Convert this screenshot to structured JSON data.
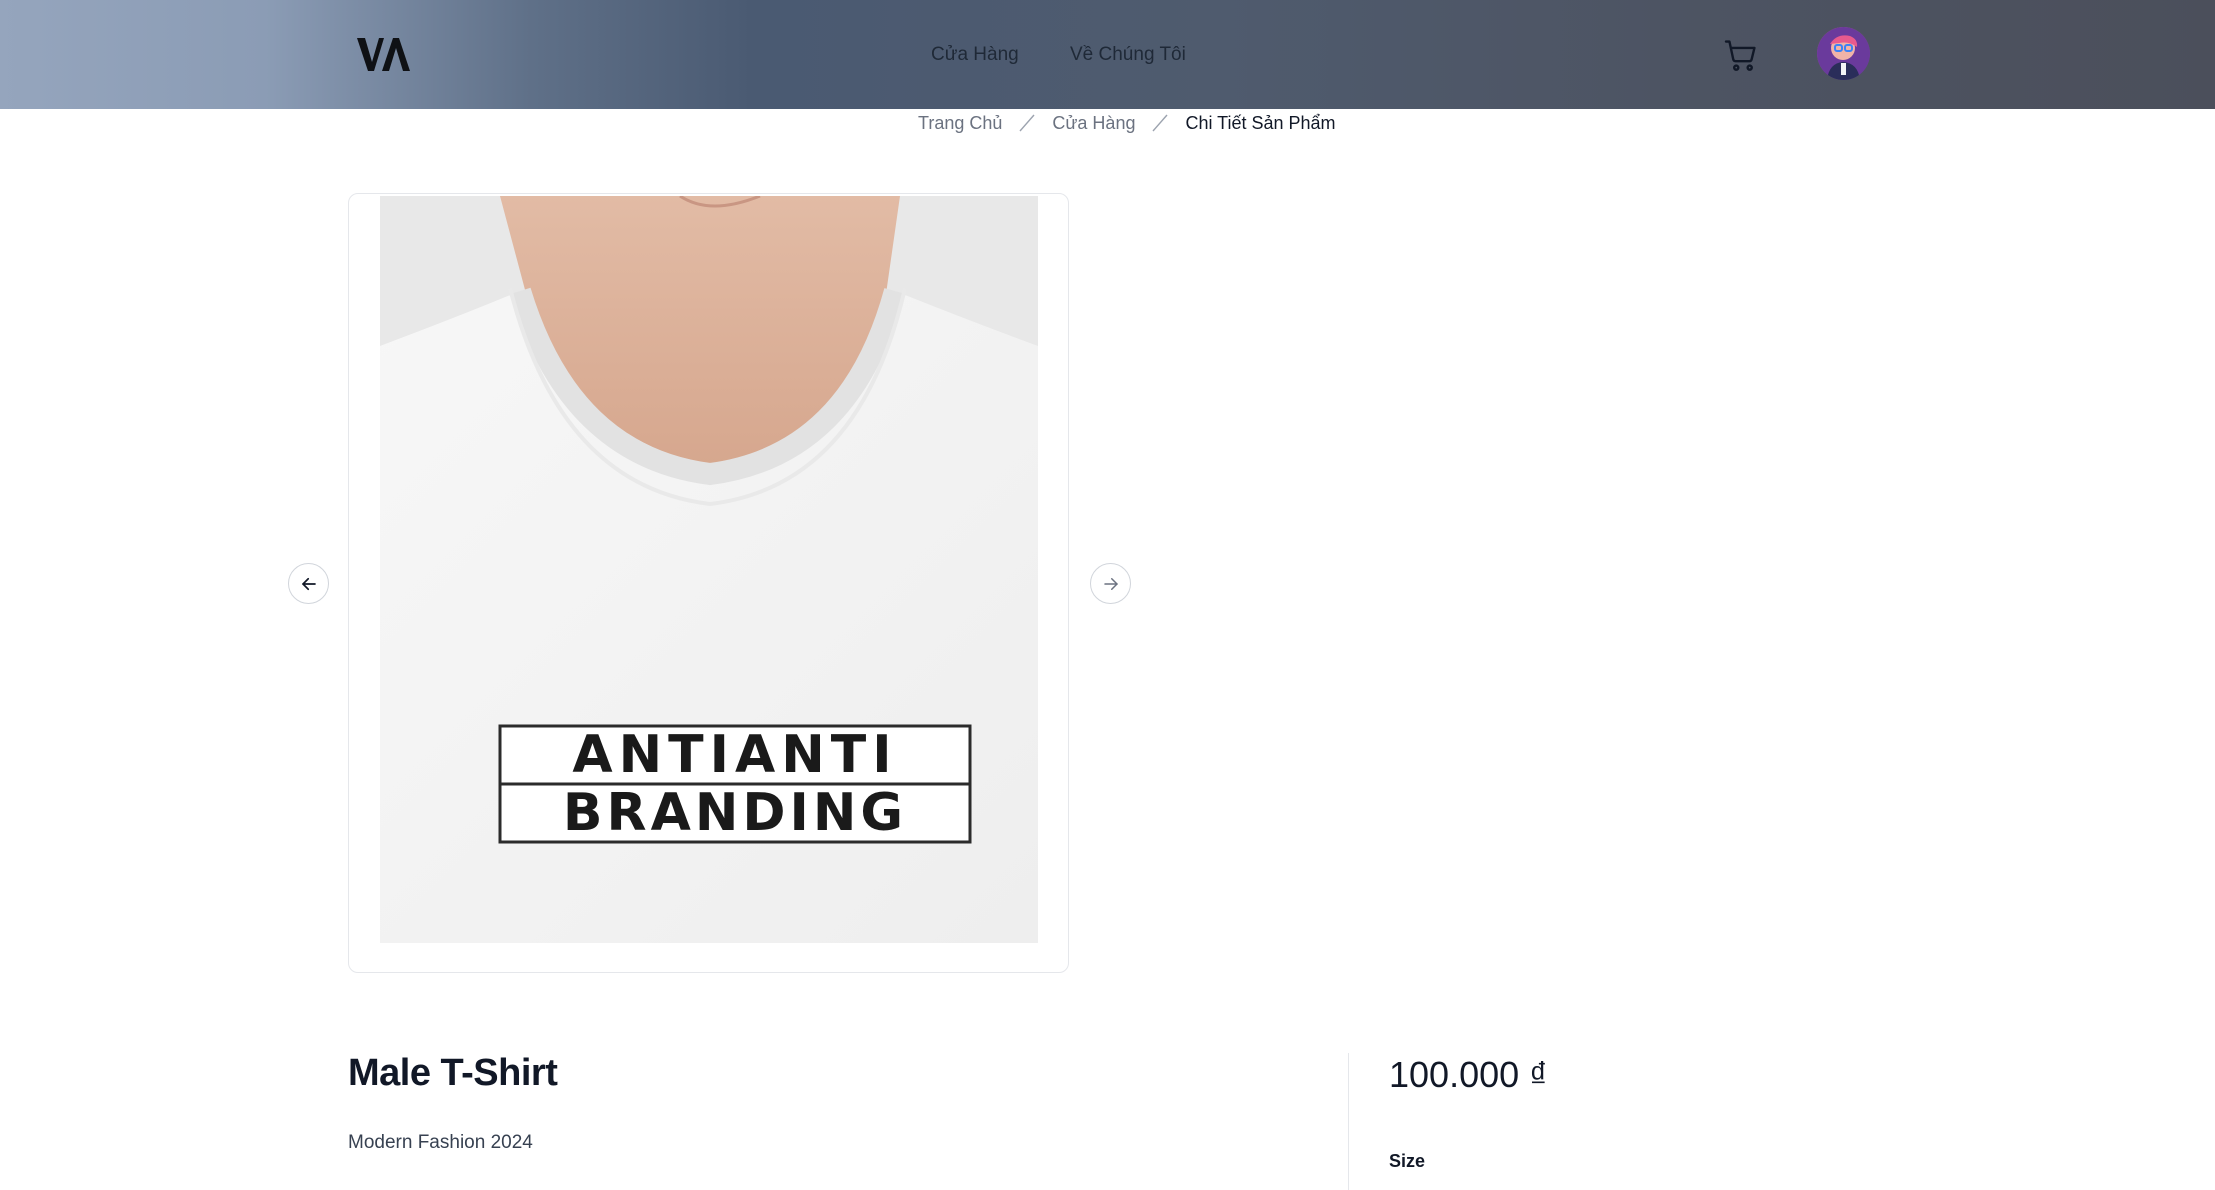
{
  "header": {
    "logo_text": "VA",
    "nav": {
      "shop_label": "Cửa Hàng",
      "about_label": "Về Chúng Tôi"
    },
    "cart_icon": "cart-icon",
    "avatar": "user-avatar"
  },
  "breadcrumb": {
    "home": "Trang Chủ",
    "shop": "Cửa Hàng",
    "current": "Chi Tiết Sản Phẩm"
  },
  "gallery": {
    "image_alt": "Male T-Shirt",
    "shirt_print_line1": "ANTIANTI",
    "shirt_print_line2": "BRANDING",
    "prev_icon": "arrow-left-icon",
    "next_icon": "arrow-right-icon"
  },
  "product": {
    "title": "Male T-Shirt",
    "subtitle": "Modern Fashion 2024",
    "price": "100.000 ₫",
    "size_label": "Size"
  },
  "colors": {
    "text_primary": "#111827",
    "text_muted": "#6b7280",
    "border": "#e5e7eb"
  }
}
